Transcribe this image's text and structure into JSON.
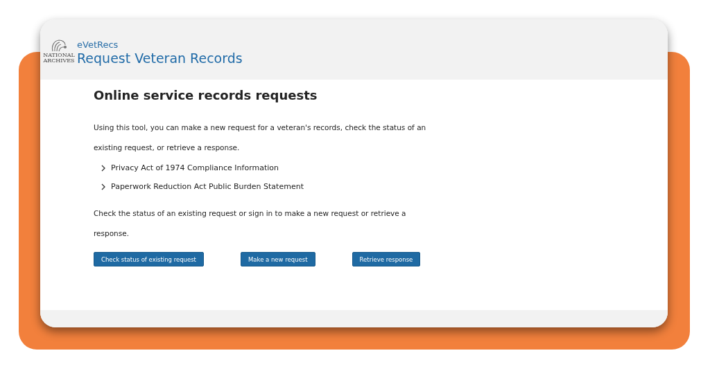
{
  "header": {
    "logo_text": [
      "NATIONAL",
      "ARCHIVES"
    ],
    "site_name": "eVetRecs",
    "title": "Request Veteran Records"
  },
  "main": {
    "heading": "Online service records requests",
    "intro": "Using this tool, you can make a new request for a veteran's records, check the status of an existing request, or retrieve a response.",
    "accordion": [
      {
        "label": "Privacy Act of 1974 Compliance Information",
        "expanded": false
      },
      {
        "label": "Paperwork Reduction Act Public Burden Statement",
        "expanded": false
      }
    ],
    "prompt": "Check the status of an existing request or sign in to make a new request or retrieve a response.",
    "buttons": [
      "Check status of existing request",
      "Make a new request",
      "Retrieve response"
    ]
  }
}
